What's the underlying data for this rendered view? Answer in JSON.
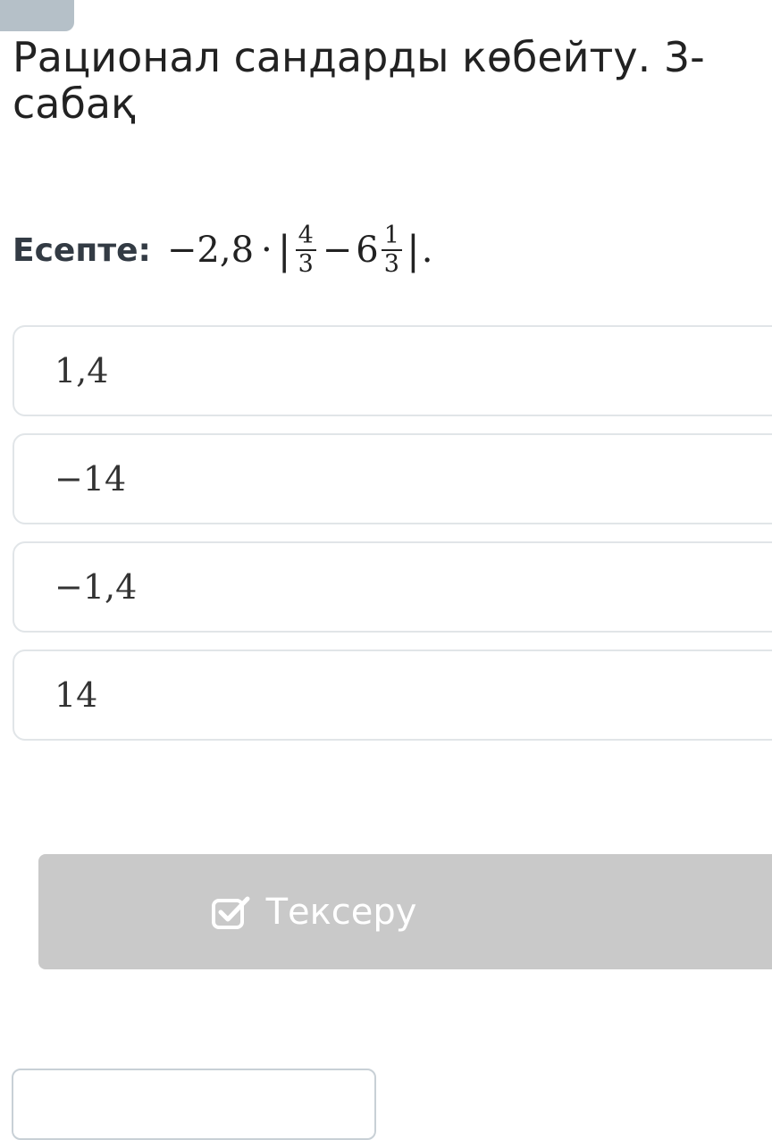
{
  "lesson": {
    "title": "Рационал сандарды көбейту. 3-сабақ"
  },
  "question": {
    "label": "Есепте:",
    "expr": {
      "sign": "−2,8",
      "dot": "·",
      "frac1": {
        "num": "4",
        "den": "3"
      },
      "minus": "−",
      "whole": "6",
      "frac2": {
        "num": "1",
        "den": "3"
      },
      "end": "."
    }
  },
  "options": [
    "1,4",
    "−14",
    "−1,4",
    "14"
  ],
  "check_button": {
    "label": "Тексеру",
    "icon": "checkbox-check-icon"
  },
  "colors": {
    "button_disabled": "#c9c9c9",
    "option_border": "#e1e5e8",
    "tab": "#b5c0c8"
  }
}
